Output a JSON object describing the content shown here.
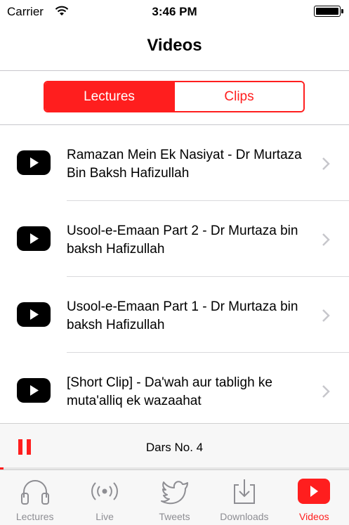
{
  "status": {
    "carrier": "Carrier",
    "time": "3:46 PM"
  },
  "nav": {
    "title": "Videos"
  },
  "segments": [
    {
      "label": "Lectures",
      "selected": true
    },
    {
      "label": "Clips",
      "selected": false
    }
  ],
  "videos": [
    {
      "title": "Ramazan Mein Ek Nasiyat - Dr Murtaza Bin Baksh Hafizullah"
    },
    {
      "title": "Usool-e-Emaan Part 2 - Dr Murtaza bin baksh Hafizullah"
    },
    {
      "title": "Usool-e-Emaan Part 1 - Dr Murtaza bin baksh Hafizullah"
    },
    {
      "title": "[Short Clip] - Da'wah aur tabligh ke muta'alliq ek wazaahat"
    }
  ],
  "player": {
    "now_playing": "Dars No. 4",
    "state": "playing",
    "progress": 0.01
  },
  "tabs": [
    {
      "label": "Lectures",
      "icon": "headphones-icon",
      "active": false
    },
    {
      "label": "Live",
      "icon": "broadcast-icon",
      "active": false
    },
    {
      "label": "Tweets",
      "icon": "twitter-bird-icon",
      "active": false
    },
    {
      "label": "Downloads",
      "icon": "download-icon",
      "active": false
    },
    {
      "label": "Videos",
      "icon": "video-play-icon",
      "active": true
    }
  ],
  "colors": {
    "accent": "#ff1e1e",
    "inactive": "#8e8e93",
    "separator": "#d9d9dd"
  }
}
